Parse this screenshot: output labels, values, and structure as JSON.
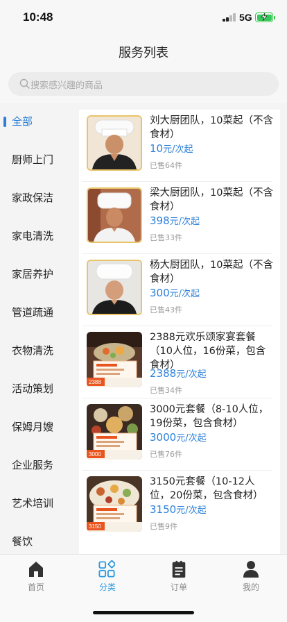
{
  "status_bar": {
    "time": "10:48",
    "network": "5G"
  },
  "header": {
    "title": "服务列表"
  },
  "search": {
    "placeholder": "搜索感兴趣的商品"
  },
  "sidebar": {
    "items": [
      {
        "label": "全部",
        "active": true
      },
      {
        "label": "厨师上门"
      },
      {
        "label": "家政保洁"
      },
      {
        "label": "家电清洗"
      },
      {
        "label": "家居养护"
      },
      {
        "label": "管道疏通"
      },
      {
        "label": "衣物清洗"
      },
      {
        "label": "活动策划"
      },
      {
        "label": "保姆月嫂"
      },
      {
        "label": "企业服务"
      },
      {
        "label": "艺术培训"
      },
      {
        "label": "餐饮"
      }
    ]
  },
  "products": [
    {
      "title": "刘大厨团队，10菜起（不含食材）",
      "price": "10",
      "unit": "元/次起",
      "sold": "已售64件",
      "image": "chef-portrait"
    },
    {
      "title": "梁大厨团队，10菜起（不含食材）",
      "price": "398",
      "unit": "元/次起",
      "sold": "已售33件",
      "image": "chef-portrait"
    },
    {
      "title": "杨大厨团队，10菜起（不含食材）",
      "price": "300",
      "unit": "元/次起",
      "sold": "已售43件",
      "image": "chef-portrait"
    },
    {
      "title": "2388元欢乐颂家宴套餐（10人位，16份菜，包含食材）",
      "price": "2388",
      "unit": "元/次起",
      "sold": "已售34件",
      "image": "banquet-photo",
      "badge": "2388"
    },
    {
      "title": "3000元套餐（8-10人位，19份菜，包含食材）",
      "price": "3000",
      "unit": "元/次起",
      "sold": "已售76件",
      "image": "banquet-photo",
      "badge": "3000"
    },
    {
      "title": "3150元套餐（10-12人位，20份菜，包含食材）",
      "price": "3150",
      "unit": "元/次起",
      "sold": "已售9件",
      "image": "banquet-photo",
      "badge": "3150"
    }
  ],
  "tabbar": {
    "items": [
      {
        "label": "首页",
        "icon": "home-icon"
      },
      {
        "label": "分类",
        "icon": "category-icon",
        "active": true
      },
      {
        "label": "订单",
        "icon": "order-icon"
      },
      {
        "label": "我的",
        "icon": "profile-icon"
      }
    ]
  },
  "colors": {
    "accent": "#2b7fd9",
    "tab_active": "#2b9be0",
    "badge": "#e8551f"
  }
}
